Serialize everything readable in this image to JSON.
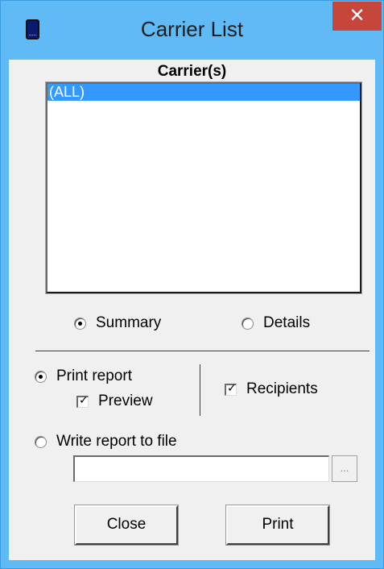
{
  "window": {
    "title": "Carrier List",
    "close_label": "✕",
    "icon": "device-icon"
  },
  "carriers": {
    "heading": "Carrier(s)",
    "items": [
      "(ALL)"
    ],
    "selected_index": 0
  },
  "report_type": {
    "summary_label": "Summary",
    "details_label": "Details",
    "selected": "Summary"
  },
  "output": {
    "print_report_label": "Print report",
    "print_report_selected": true,
    "preview_label": "Preview",
    "preview_checked": true,
    "recipients_label": "Recipients",
    "recipients_checked": true,
    "write_file_label": "Write report to file",
    "write_file_selected": false,
    "file_path_value": "",
    "browse_label": "..."
  },
  "buttons": {
    "close_label": "Close",
    "print_label": "Print"
  },
  "colors": {
    "title_bar": "#5fbaf5",
    "close_button": "#c7463c",
    "selection": "#3399ff",
    "client_background": "#f0f0f0"
  }
}
